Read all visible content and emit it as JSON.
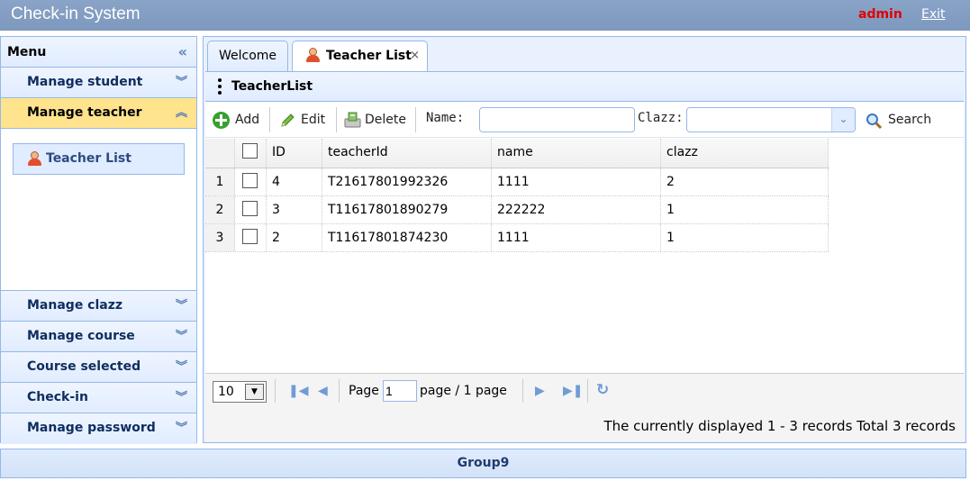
{
  "app": {
    "title": "Check-in System",
    "user": "admin",
    "exit_label": "Exit"
  },
  "sidebar": {
    "header": "Menu",
    "collapse_glyph": "«",
    "items": [
      {
        "label": "Manage student",
        "state": "collapsed"
      },
      {
        "label": "Manage teacher",
        "state": "expanded"
      },
      {
        "label": "Manage clazz",
        "state": "collapsed"
      },
      {
        "label": "Manage course",
        "state": "collapsed"
      },
      {
        "label": "Course selected",
        "state": "collapsed"
      },
      {
        "label": "Check-in",
        "state": "collapsed"
      },
      {
        "label": "Manage password",
        "state": "collapsed"
      }
    ],
    "sub_item": {
      "label": "Teacher List",
      "icon": "person-icon"
    }
  },
  "tabs": [
    {
      "label": "Welcome"
    },
    {
      "label": "Teacher List",
      "close_glyph": "×",
      "icon": "person-icon"
    }
  ],
  "panel": {
    "title": "TeacherList"
  },
  "toolbar": {
    "add_label": "Add",
    "edit_label": "Edit",
    "delete_label": "Delete",
    "name_label": "Name:",
    "name_value": "",
    "clazz_label": "Clazz:",
    "clazz_value": "",
    "search_label": "Search"
  },
  "table": {
    "columns": [
      "ID",
      "teacherId",
      "name",
      "clazz"
    ],
    "rows": [
      {
        "num": "1",
        "id": "4",
        "teacherId": "T21617801992326",
        "name": "1111",
        "clazz": "2"
      },
      {
        "num": "2",
        "id": "3",
        "teacherId": "T11617801890279",
        "name": "222222",
        "clazz": "1"
      },
      {
        "num": "3",
        "id": "2",
        "teacherId": "T11617801874230",
        "name": "1111",
        "clazz": "1"
      }
    ]
  },
  "pager": {
    "page_size": "10",
    "page_label": "Page",
    "page_value": "1",
    "page_total_text": "page / 1 page",
    "summary": "The currently displayed 1 - 3 records Total 3 records"
  },
  "footer": {
    "text": "Group9"
  },
  "colors": {
    "accent": "#95b8e7",
    "active_menu": "#ffe48d",
    "user": "#e00000"
  }
}
